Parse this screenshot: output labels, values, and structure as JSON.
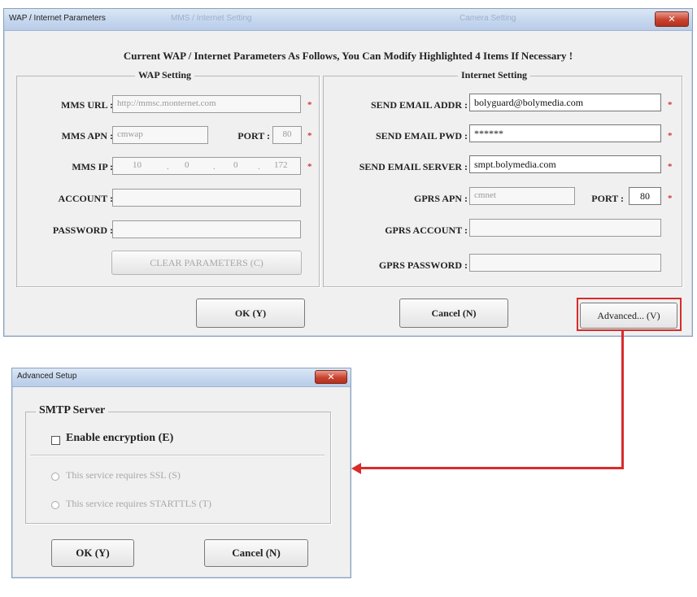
{
  "main_window": {
    "title": "WAP / Internet Parameters",
    "title_ghosts": [
      "MMS / Internet Setting",
      "Camera Setting"
    ],
    "close_label": "✕",
    "heading": "Current WAP / Internet Parameters As Follows, You Can Modify Highlighted 4 Items If Necessary !",
    "wap": {
      "title": "WAP Setting",
      "mms_url_label": "MMS URL :",
      "mms_url_value": "http://mmsc.monternet.com",
      "mms_apn_label": "MMS APN :",
      "mms_apn_value": "cmwap",
      "port_label": "PORT :",
      "port_value": "80",
      "mms_ip_label": "MMS IP :",
      "mms_ip": [
        "10",
        "0",
        "0",
        "172"
      ],
      "account_label": "ACCOUNT :",
      "account_value": "",
      "password_label": "PASSWORD :",
      "password_value": "",
      "clear_label": "CLEAR PARAMETERS (C)"
    },
    "internet": {
      "title": "Internet Setting",
      "email_addr_label": "SEND EMAIL ADDR :",
      "email_addr_value": "bolyguard@bolymedia.com",
      "email_pwd_label": "SEND EMAIL PWD :",
      "email_pwd_value": "******",
      "email_server_label": "SEND EMAIL SERVER :",
      "email_server_value": "smpt.bolymedia.com",
      "gprs_apn_label": "GPRS APN :",
      "gprs_apn_value": "cmnet",
      "port_label": "PORT :",
      "port_value": "80",
      "gprs_account_label": "GPRS ACCOUNT :",
      "gprs_account_value": "",
      "gprs_password_label": "GPRS PASSWORD :",
      "gprs_password_value": ""
    },
    "required_marker": "*",
    "ok_label": "OK (Y)",
    "cancel_label": "Cancel (N)",
    "advanced_label": "Advanced... (V)"
  },
  "advanced_window": {
    "title": "Advanced Setup",
    "close_label": "✕",
    "group_title": "SMTP Server",
    "enable_encryption_label": "Enable encryption (E)",
    "enable_encryption_checked": false,
    "ssl_label": "This service requires SSL (S)",
    "starttls_label": "This service requires STARTTLS (T)",
    "ok_label": "OK (Y)",
    "cancel_label": "Cancel (N)"
  },
  "colors": {
    "highlight": "#d92b2b",
    "required_marker": "#d23a3a",
    "window_bg": "#f0f0f0"
  }
}
